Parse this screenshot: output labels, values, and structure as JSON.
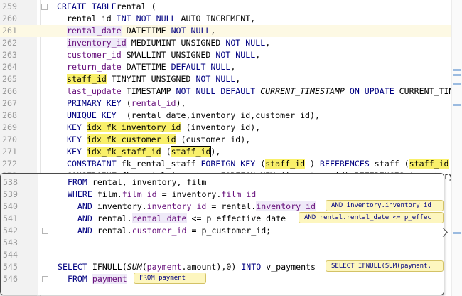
{
  "editor": {
    "lines": [
      {
        "n": "259",
        "parts": [
          [
            "kw",
            "CREATE TABLE"
          ],
          [
            "",
            "rental ("
          ]
        ]
      },
      {
        "n": "260",
        "parts": [
          [
            "",
            "  rental_id "
          ],
          [
            "kw",
            "INT NOT NULL"
          ],
          [
            "",
            " AUTO_INCREMENT,"
          ]
        ]
      },
      {
        "n": "261",
        "parts": [
          [
            "",
            "  "
          ],
          [
            "sv",
            "rental_date"
          ],
          [
            "",
            " DATETIME "
          ],
          [
            "kw",
            "NOT NULL"
          ],
          [
            "",
            ","
          ]
        ]
      },
      {
        "n": "262",
        "parts": [
          [
            "",
            "  "
          ],
          [
            "sv",
            "inventory_id"
          ],
          [
            "",
            " MEDIUMINT UNSIGNED "
          ],
          [
            "kw",
            "NOT NULL"
          ],
          [
            "",
            ","
          ]
        ]
      },
      {
        "n": "263",
        "parts": [
          [
            "",
            "  "
          ],
          [
            "id",
            "customer_id"
          ],
          [
            "",
            " SMALLINT UNSIGNED "
          ],
          [
            "kw",
            "NOT NULL"
          ],
          [
            "",
            ","
          ]
        ]
      },
      {
        "n": "264",
        "parts": [
          [
            "",
            "  "
          ],
          [
            "id",
            "return_date"
          ],
          [
            "",
            " DATETIME "
          ],
          [
            "kw",
            "DEFAULT NULL"
          ],
          [
            "",
            ","
          ]
        ]
      },
      {
        "n": "265",
        "parts": [
          [
            "",
            "  "
          ],
          [
            "hl",
            "staff_id"
          ],
          [
            "",
            " TINYINT UNSIGNED "
          ],
          [
            "kw",
            "NOT NULL"
          ],
          [
            "",
            ","
          ]
        ]
      },
      {
        "n": "266",
        "parts": [
          [
            "",
            "  "
          ],
          [
            "id",
            "last_update"
          ],
          [
            "",
            " TIMESTAMP "
          ],
          [
            "kw",
            "NOT NULL DEFAULT"
          ],
          [
            "",
            " "
          ],
          [
            "it",
            "CURRENT_TIMESTAMP"
          ],
          [
            "",
            " "
          ],
          [
            "kw",
            "ON UPDATE"
          ],
          [
            "",
            " CURRENT_TIMES"
          ]
        ]
      },
      {
        "n": "267",
        "parts": [
          [
            "",
            "  "
          ],
          [
            "kw",
            "PRIMARY KEY"
          ],
          [
            "",
            " ("
          ],
          [
            "id",
            "rental_id"
          ],
          [
            "",
            "),"
          ]
        ]
      },
      {
        "n": "268",
        "parts": [
          [
            "",
            "  "
          ],
          [
            "kw",
            "UNIQUE KEY"
          ],
          [
            "",
            "  (rental_date,inventory_id,customer_id),"
          ]
        ]
      },
      {
        "n": "269",
        "parts": [
          [
            "",
            "  "
          ],
          [
            "kw",
            "KEY"
          ],
          [
            "",
            " "
          ],
          [
            "hl",
            "idx_fk_inventory_id"
          ],
          [
            "",
            " (inventory_id),"
          ]
        ]
      },
      {
        "n": "270",
        "parts": [
          [
            "",
            "  "
          ],
          [
            "kw",
            "KEY"
          ],
          [
            "",
            " "
          ],
          [
            "hl",
            "idx_fk_customer_id"
          ],
          [
            "",
            " (customer_id),"
          ]
        ]
      },
      {
        "n": "271",
        "parts": [
          [
            "",
            "  "
          ],
          [
            "kw",
            "KEY"
          ],
          [
            "",
            " "
          ],
          [
            "hl",
            "idx_fk_staff_id"
          ],
          [
            "",
            " ("
          ],
          [
            "hlb",
            "staff_id"
          ],
          [
            "",
            "),"
          ]
        ]
      },
      {
        "n": "272",
        "parts": [
          [
            "",
            "  "
          ],
          [
            "kw",
            "CONSTRAINT"
          ],
          [
            "",
            " fk_rental_staff "
          ],
          [
            "kw",
            "FOREIGN KEY"
          ],
          [
            "",
            " ("
          ],
          [
            "hl",
            "staff_id"
          ],
          [
            "",
            " ) "
          ],
          [
            "kw",
            "REFERENCES"
          ],
          [
            "",
            " staff ("
          ],
          [
            "hl",
            "staff_id"
          ],
          [
            "",
            " ) "
          ],
          [
            "kw",
            "ON"
          ]
        ]
      },
      {
        "n": "273",
        "parts": [
          [
            "",
            "  CONSTRAINT fk_rental_inventory FOREIGN KEY (inventory_id) REFERENCES inventory (in"
          ]
        ]
      }
    ]
  },
  "popup": {
    "lines": [
      {
        "n": "538",
        "parts": [
          [
            "",
            "  "
          ],
          [
            "kw",
            "FROM"
          ],
          [
            "",
            " rental, inventory, film"
          ]
        ]
      },
      {
        "n": "539",
        "parts": [
          [
            "",
            "  "
          ],
          [
            "kw",
            "WHERE"
          ],
          [
            "",
            " film."
          ],
          [
            "id",
            "film_id"
          ],
          [
            "",
            " = inventory."
          ],
          [
            "id",
            "film_id"
          ]
        ]
      },
      {
        "n": "540",
        "parts": [
          [
            "",
            "    "
          ],
          [
            "kw",
            "AND"
          ],
          [
            "",
            " inventory."
          ],
          [
            "id",
            "inventory_id"
          ],
          [
            "",
            " = rental."
          ],
          [
            "sv",
            "inventory_id"
          ]
        ]
      },
      {
        "n": "541",
        "parts": [
          [
            "",
            "    "
          ],
          [
            "kw",
            "AND"
          ],
          [
            "",
            " rental."
          ],
          [
            "sv",
            "rental_date"
          ],
          [
            "",
            " <= p_effective_date"
          ]
        ]
      },
      {
        "n": "542",
        "parts": [
          [
            "",
            "    "
          ],
          [
            "kw",
            "AND"
          ],
          [
            "",
            " rental."
          ],
          [
            "id",
            "customer_id"
          ],
          [
            "",
            " = p_customer_id;"
          ]
        ]
      },
      {
        "n": "543",
        "parts": []
      },
      {
        "n": "544",
        "parts": []
      },
      {
        "n": "545",
        "parts": [
          [
            "",
            ""
          ],
          [
            "kw",
            "SELECT"
          ],
          [
            "",
            " IFNULL("
          ],
          [
            "it",
            "SUM"
          ],
          [
            "",
            "("
          ],
          [
            "id",
            "payment"
          ],
          [
            "",
            ".amount),0) "
          ],
          [
            "kw",
            "INTO"
          ],
          [
            "",
            " v_payments"
          ]
        ]
      },
      {
        "n": "546",
        "parts": [
          [
            "",
            "  "
          ],
          [
            "kw",
            "FROM"
          ],
          [
            "",
            " "
          ],
          [
            "sv",
            "payment"
          ]
        ]
      }
    ],
    "hints": [
      "AND inventory.inventory_id",
      "AND rental.rental_date <= p_effec",
      "SELECT IFNULL(SUM(payment.",
      "FROM payment"
    ],
    "peek_right": [
      ") ON",
      ")",
      ". (ir",
      "custo"
    ]
  }
}
